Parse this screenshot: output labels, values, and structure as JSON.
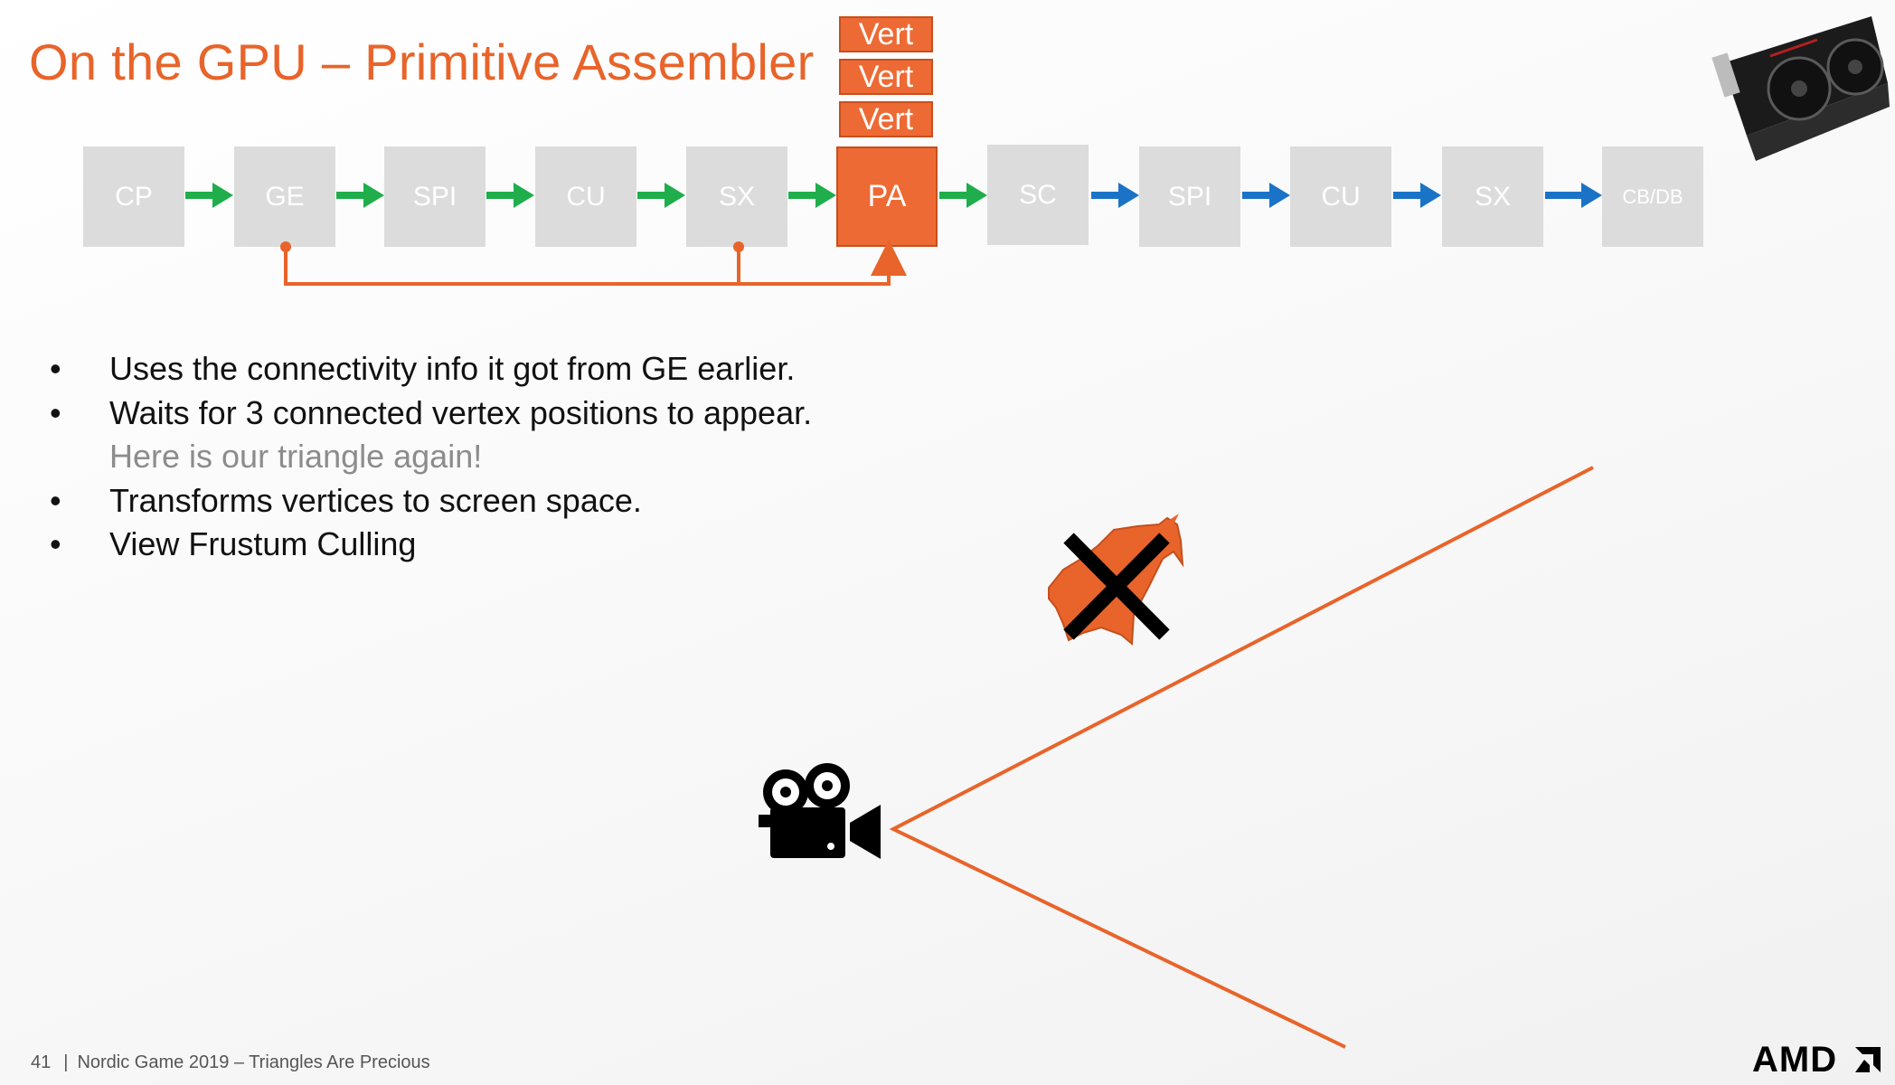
{
  "slide": {
    "title": "On the GPU – Primitive Assembler",
    "pipeline": {
      "stages": [
        "CP",
        "GE",
        "SPI",
        "CU",
        "SX",
        "PA",
        "SC",
        "SPI",
        "CU",
        "SX",
        "CB/DB"
      ],
      "active_stage": "PA",
      "vert_labels": [
        "Vert",
        "Vert",
        "Vert"
      ]
    },
    "bullets": [
      {
        "text": "Uses the connectivity info it got from GE earlier.",
        "marker": "•"
      },
      {
        "text": "Waits for 3 connected vertex positions to appear.",
        "marker": "•"
      },
      {
        "text": "Here is our triangle again!",
        "marker": ""
      },
      {
        "text": "Transforms vertices to screen space.",
        "marker": "•"
      },
      {
        "text": "View Frustum Culling",
        "marker": "•"
      }
    ],
    "footer": {
      "page_number": "41",
      "separator": "|",
      "text": "Nordic Game 2019 – Triangles Are Precious"
    },
    "logo_text": "AMD",
    "colors": {
      "accent_orange": "#e8642a",
      "stage_gray": "#dcdcdc",
      "arrow_green": "#1fae4b",
      "arrow_blue": "#1a73c6",
      "sub_text_gray": "#8c8c8c"
    },
    "icons": [
      "gpu-card-icon",
      "movie-camera-icon",
      "unicorn-icon",
      "cross-icon",
      "amd-arrow-icon"
    ]
  }
}
